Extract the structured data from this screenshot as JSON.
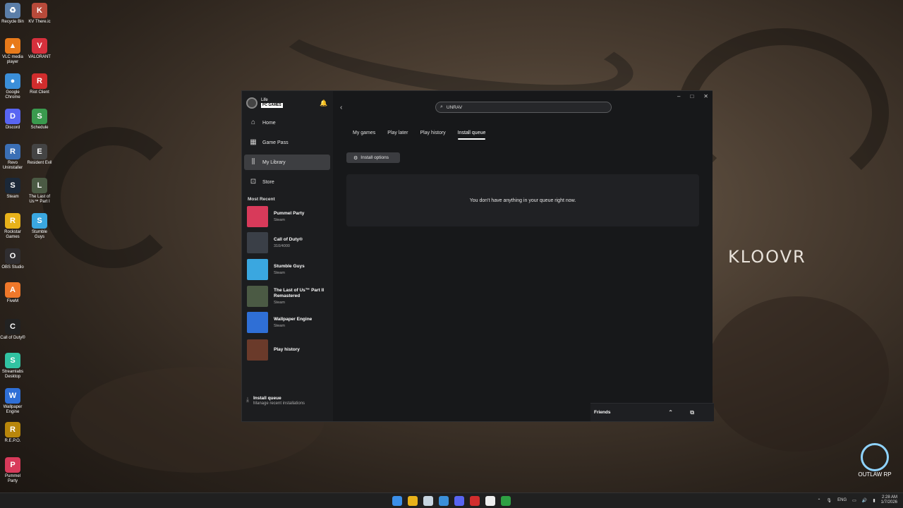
{
  "desktop": {
    "icons": [
      {
        "label": "Recycle Bin",
        "color": "#5b7ea8",
        "glyph": "♻"
      },
      {
        "label": "KV There.ic",
        "color": "#b84a3a",
        "glyph": "K"
      },
      {
        "label": "VLC media player",
        "color": "#e87a1a",
        "glyph": "▲"
      },
      {
        "label": "VALORANT",
        "color": "#d6303c",
        "glyph": "V"
      },
      {
        "label": "Google Chrome",
        "color": "#3b8fd9",
        "glyph": "●"
      },
      {
        "label": "Riot Client",
        "color": "#d12d2d",
        "glyph": "R"
      },
      {
        "label": "Discord",
        "color": "#5865f2",
        "glyph": "D"
      },
      {
        "label": "Schedule",
        "color": "#3a9a4e",
        "glyph": "S"
      },
      {
        "label": "Revo Uninstaller",
        "color": "#3b6fb5",
        "glyph": "R"
      },
      {
        "label": "Resident Evil",
        "color": "#444444",
        "glyph": "E"
      },
      {
        "label": "Steam",
        "color": "#1b2838",
        "glyph": "S"
      },
      {
        "label": "The Last of Us™ Part I",
        "color": "#4b5a44",
        "glyph": "L"
      },
      {
        "label": "Rockstar Games",
        "color": "#e8b21a",
        "glyph": "R"
      },
      {
        "label": "Stumble Guys",
        "color": "#3aa7e0",
        "glyph": "S"
      },
      {
        "label": "OBS Studio",
        "color": "#302e31",
        "glyph": "O"
      },
      {
        "label": "FiveM",
        "color": "#f0782a",
        "glyph": "A"
      },
      {
        "label": "Call of Duty®",
        "color": "#222222",
        "glyph": "C"
      },
      {
        "label": "Streamlabs Desktop",
        "color": "#31c3a2",
        "glyph": "S"
      },
      {
        "label": "Wallpaper Engine",
        "color": "#2f6fd6",
        "glyph": "W"
      },
      {
        "label": "R.E.P.O.",
        "color": "#b8860b",
        "glyph": "R"
      },
      {
        "label": "Pummel Party",
        "color": "#d83a5a",
        "glyph": "P"
      }
    ],
    "watermark": "KLOOVR",
    "outlaw_label": "OUTLAW RP"
  },
  "window": {
    "brand_line1": "Life",
    "brand_line2": "PC GAMES",
    "nav": [
      {
        "label": "Home",
        "icon": "home-icon",
        "glyph": "⌂"
      },
      {
        "label": "Game Pass",
        "icon": "game-pass-icon",
        "glyph": "▦"
      },
      {
        "label": "My Library",
        "icon": "library-icon",
        "glyph": "⫼"
      },
      {
        "label": "Store",
        "icon": "store-icon",
        "glyph": "⊡"
      }
    ],
    "most_recent_label": "Most Recent",
    "recent": [
      {
        "name": "Pummel Party",
        "sub": "Steam",
        "color": "#d83a5a"
      },
      {
        "name": "Call of Duty®",
        "sub": "310/4000",
        "color": "#3a3f47"
      },
      {
        "name": "Stumble Guys",
        "sub": "Steam",
        "color": "#3aa7e0"
      },
      {
        "name": "The Last of Us™ Part II Remastered",
        "sub": "Steam",
        "color": "#4b5a44"
      },
      {
        "name": "Wallpaper Engine",
        "sub": "Steam",
        "color": "#2f6fd6"
      },
      {
        "name": "Play history",
        "sub": "",
        "color": "#6a3a2a"
      }
    ],
    "install_queue_title": "Install queue",
    "install_queue_sub": "Manage recent installations",
    "search_value": "UNRAV",
    "tabs": [
      "My games",
      "Play later",
      "Play history",
      "Install queue"
    ],
    "active_tab": "Install queue",
    "install_options_label": "Install options",
    "empty_message": "You don't have anything in your queue right now.",
    "friends_label": "Friends"
  },
  "taskbar": {
    "lang": "ENG",
    "time": "2:28 AM",
    "date": "1/7/2026",
    "apps": [
      {
        "name": "start",
        "color": "#3b8fe8"
      },
      {
        "name": "file-explorer",
        "color": "#e8b21a"
      },
      {
        "name": "steam",
        "color": "#c7d5e0"
      },
      {
        "name": "chrome",
        "color": "#3b8fd9"
      },
      {
        "name": "discord",
        "color": "#5865f2"
      },
      {
        "name": "riot-client",
        "color": "#d12d2d"
      },
      {
        "name": "capcut",
        "color": "#eeeeee"
      },
      {
        "name": "xbox",
        "color": "#2ea043"
      }
    ]
  }
}
